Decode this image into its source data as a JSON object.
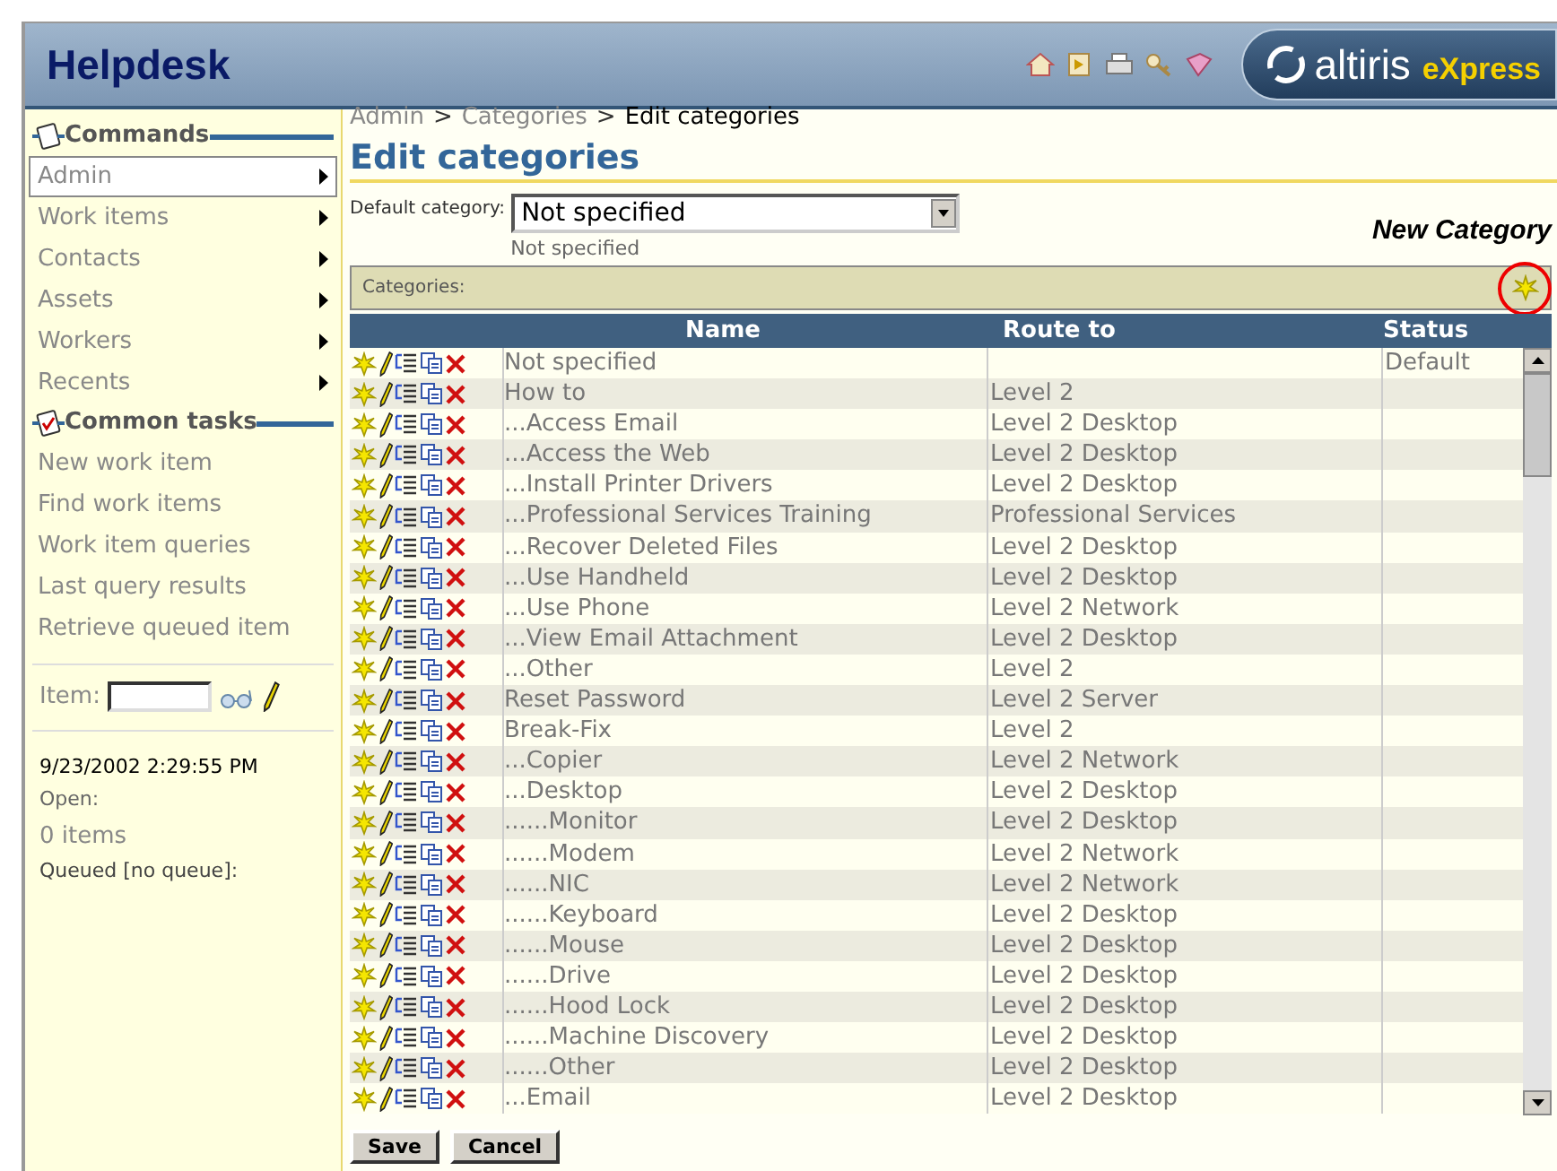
{
  "header": {
    "title": "Helpdesk",
    "logo": {
      "brand": "altiris",
      "product": "eXpress"
    }
  },
  "sidebar": {
    "sections": [
      {
        "title": "Commands",
        "kind": "commands",
        "items": [
          {
            "label": "Admin",
            "selected": true
          },
          {
            "label": "Work items",
            "selected": false
          },
          {
            "label": "Contacts",
            "selected": false
          },
          {
            "label": "Assets",
            "selected": false
          },
          {
            "label": "Workers",
            "selected": false
          },
          {
            "label": "Recents",
            "selected": false
          }
        ]
      },
      {
        "title": "Common tasks",
        "kind": "tasks",
        "items": [
          {
            "label": "New work item",
            "selected": false
          },
          {
            "label": "Find work items",
            "selected": false
          },
          {
            "label": "Work item queries",
            "selected": false
          },
          {
            "label": "Last query results",
            "selected": false
          },
          {
            "label": "Retrieve queued item",
            "selected": false
          }
        ]
      }
    ],
    "item_field": {
      "label": "Item:"
    },
    "status": {
      "datetime": "9/23/2002 2:29:55 PM",
      "open_label": "Open:",
      "open_count": "0 items",
      "queued_label": "Queued [no queue]:"
    }
  },
  "breadcrumb": [
    {
      "label": "Admin",
      "link": true
    },
    {
      "label": "Categories",
      "link": true
    },
    {
      "label": "Edit categories",
      "link": false
    }
  ],
  "breadcrumb_separator": ">",
  "page_title": "Edit categories",
  "default_category": {
    "label": "Default category:",
    "value": "Not specified",
    "note": "Not specified"
  },
  "callout": "New Category",
  "categories": {
    "title": "Categories:",
    "columns": [
      "Name",
      "Route to",
      "Status"
    ],
    "rows": [
      {
        "name": "Not specified",
        "route": "",
        "status": "Default"
      },
      {
        "name": "How to",
        "route": "Level 2",
        "status": ""
      },
      {
        "name": "...Access Email",
        "route": "Level 2 Desktop",
        "status": ""
      },
      {
        "name": "...Access the Web",
        "route": "Level 2 Desktop",
        "status": ""
      },
      {
        "name": "...Install Printer Drivers",
        "route": "Level 2 Desktop",
        "status": ""
      },
      {
        "name": "...Professional Services Training",
        "route": "Professional Services",
        "status": ""
      },
      {
        "name": "...Recover Deleted Files",
        "route": "Level 2 Desktop",
        "status": ""
      },
      {
        "name": "...Use Handheld",
        "route": "Level 2 Desktop",
        "status": ""
      },
      {
        "name": "...Use Phone",
        "route": "Level 2 Network",
        "status": ""
      },
      {
        "name": "...View Email Attachment",
        "route": "Level 2 Desktop",
        "status": ""
      },
      {
        "name": "...Other",
        "route": "Level 2",
        "status": ""
      },
      {
        "name": "Reset Password",
        "route": "Level 2 Server",
        "status": ""
      },
      {
        "name": "Break-Fix",
        "route": "Level 2",
        "status": ""
      },
      {
        "name": "...Copier",
        "route": "Level 2 Network",
        "status": ""
      },
      {
        "name": "...Desktop",
        "route": "Level 2 Desktop",
        "status": ""
      },
      {
        "name": "......Monitor",
        "route": "Level 2 Desktop",
        "status": ""
      },
      {
        "name": "......Modem",
        "route": "Level 2 Network",
        "status": ""
      },
      {
        "name": "......NIC",
        "route": "Level 2 Network",
        "status": ""
      },
      {
        "name": "......Keyboard",
        "route": "Level 2 Desktop",
        "status": ""
      },
      {
        "name": "......Mouse",
        "route": "Level 2 Desktop",
        "status": ""
      },
      {
        "name": "......Drive",
        "route": "Level 2 Desktop",
        "status": ""
      },
      {
        "name": "......Hood Lock",
        "route": "Level 2 Desktop",
        "status": ""
      },
      {
        "name": "......Machine Discovery",
        "route": "Level 2 Desktop",
        "status": ""
      },
      {
        "name": "......Other",
        "route": "Level 2 Desktop",
        "status": ""
      },
      {
        "name": "...Email",
        "route": "Level 2 Desktop",
        "status": ""
      }
    ]
  },
  "buttons": [
    "Save",
    "Cancel"
  ]
}
